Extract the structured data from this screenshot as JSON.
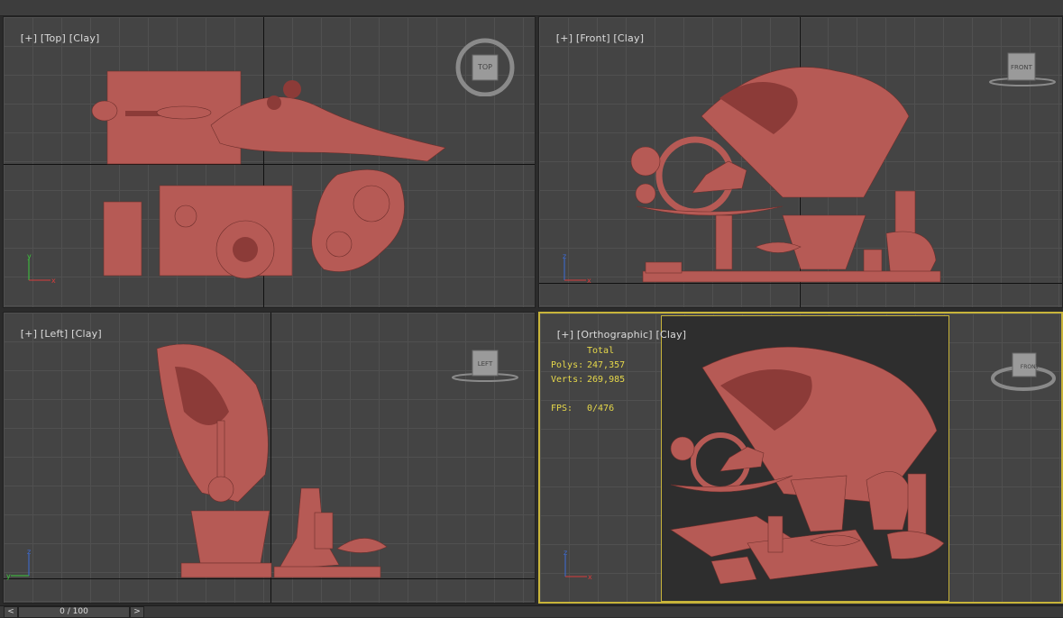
{
  "viewports": {
    "top": {
      "plus": "[+]",
      "view": "[Top]",
      "shading": "[Clay]",
      "cube": "TOP"
    },
    "front": {
      "plus": "[+]",
      "view": "[Front]",
      "shading": "[Clay]",
      "cube": "FRONT"
    },
    "left": {
      "plus": "[+]",
      "view": "[Left]",
      "shading": "[Clay]",
      "cube": "LEFT"
    },
    "persp": {
      "plus": "[+]",
      "view": "[Orthographic]",
      "shading": "[Clay]",
      "cube": "FRONT"
    }
  },
  "stats": {
    "header": "Total",
    "polys_label": "Polys:",
    "polys_value": "247,357",
    "verts_label": "Verts:",
    "verts_value": "269,985",
    "fps_label": "FPS:",
    "fps_value": "0/476"
  },
  "timeline": {
    "frame": "0 / 100",
    "prev": "<",
    "next": ">"
  },
  "axes": {
    "x": "x",
    "y": "y",
    "z": "z"
  },
  "colors": {
    "clay": "#b65a55",
    "active_border": "#c8b43a",
    "stats_text": "#e6d84a",
    "viewport_bg": "#444444"
  }
}
